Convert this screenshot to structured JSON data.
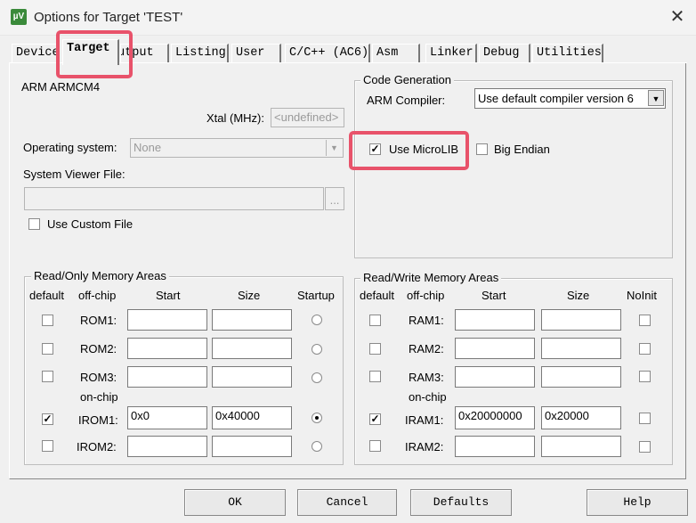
{
  "window": {
    "title": "Options for Target 'TEST'",
    "icon_text": "µV"
  },
  "tabs": [
    "Device",
    "Target",
    "Output",
    "Listing",
    "User",
    "C/C++ (AC6)",
    "Asm",
    "Linker",
    "Debug",
    "Utilities"
  ],
  "target": {
    "device_name": "ARM ARMCM4",
    "xtal_label": "Xtal (MHz):",
    "xtal_value": "<undefined>",
    "os_label": "Operating system:",
    "os_value": "None",
    "svf_label": "System Viewer File:",
    "svf_value": "",
    "browse_label": "...",
    "custom_file_label": "Use Custom File",
    "custom_file_checked": false
  },
  "code_gen": {
    "title": "Code Generation",
    "compiler_label": "ARM Compiler:",
    "compiler_value": "Use default compiler version 6",
    "microlib_label": "Use MicroLIB",
    "microlib_checked": true,
    "big_endian_label": "Big Endian",
    "big_endian_checked": false
  },
  "rom": {
    "title": "Read/Only Memory Areas",
    "headers": [
      "default",
      "off-chip",
      "Start",
      "Size",
      "Startup"
    ],
    "onchip_label": "on-chip",
    "rows": [
      {
        "name": "ROM1:",
        "start": "",
        "size": "",
        "default": false,
        "startup": false
      },
      {
        "name": "ROM2:",
        "start": "",
        "size": "",
        "default": false,
        "startup": false
      },
      {
        "name": "ROM3:",
        "start": "",
        "size": "",
        "default": false,
        "startup": false
      },
      {
        "name": "IROM1:",
        "start": "0x0",
        "size": "0x40000",
        "default": true,
        "startup": true
      },
      {
        "name": "IROM2:",
        "start": "",
        "size": "",
        "default": false,
        "startup": false
      }
    ]
  },
  "ram": {
    "title": "Read/Write Memory Areas",
    "headers": [
      "default",
      "off-chip",
      "Start",
      "Size",
      "NoInit"
    ],
    "onchip_label": "on-chip",
    "rows": [
      {
        "name": "RAM1:",
        "start": "",
        "size": "",
        "default": false,
        "noinit": false
      },
      {
        "name": "RAM2:",
        "start": "",
        "size": "",
        "default": false,
        "noinit": false
      },
      {
        "name": "RAM3:",
        "start": "",
        "size": "",
        "default": false,
        "noinit": false
      },
      {
        "name": "IRAM1:",
        "start": "0x20000000",
        "size": "0x20000",
        "default": true,
        "noinit": false
      },
      {
        "name": "IRAM2:",
        "start": "",
        "size": "",
        "default": false,
        "noinit": false
      }
    ]
  },
  "buttons": {
    "ok": "OK",
    "cancel": "Cancel",
    "defaults": "Defaults",
    "help": "Help"
  },
  "colors": {
    "highlight": "#e8526a"
  }
}
